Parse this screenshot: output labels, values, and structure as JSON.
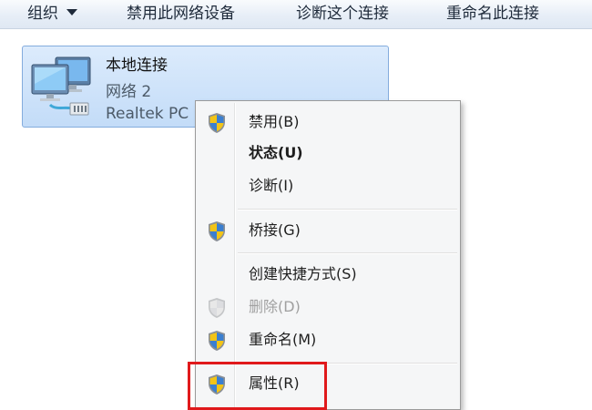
{
  "toolbar": {
    "organize_label": "组织",
    "disable_label": "禁用此网络设备",
    "diagnose_label": "诊断这个连接",
    "rename_label": "重命名此连接"
  },
  "connection": {
    "name": "本地连接",
    "network": "网络  2",
    "adapter": "Realtek PC",
    "icon": "network-adapter-icon"
  },
  "context_menu": {
    "items": [
      {
        "label": "禁用(B)",
        "icon": "uac-shield-icon"
      },
      {
        "label": "状态(U)",
        "bold": true
      },
      {
        "label": "诊断(I)"
      },
      {
        "label": "桥接(G)",
        "icon": "uac-shield-icon"
      },
      {
        "label": "创建快捷方式(S)"
      },
      {
        "label": "删除(D)",
        "icon": "uac-shield-icon",
        "disabled": true
      },
      {
        "label": "重命名(M)",
        "icon": "uac-shield-icon"
      },
      {
        "label": "属性(R)",
        "icon": "uac-shield-icon"
      }
    ],
    "highlight_color": "#e0191b"
  }
}
